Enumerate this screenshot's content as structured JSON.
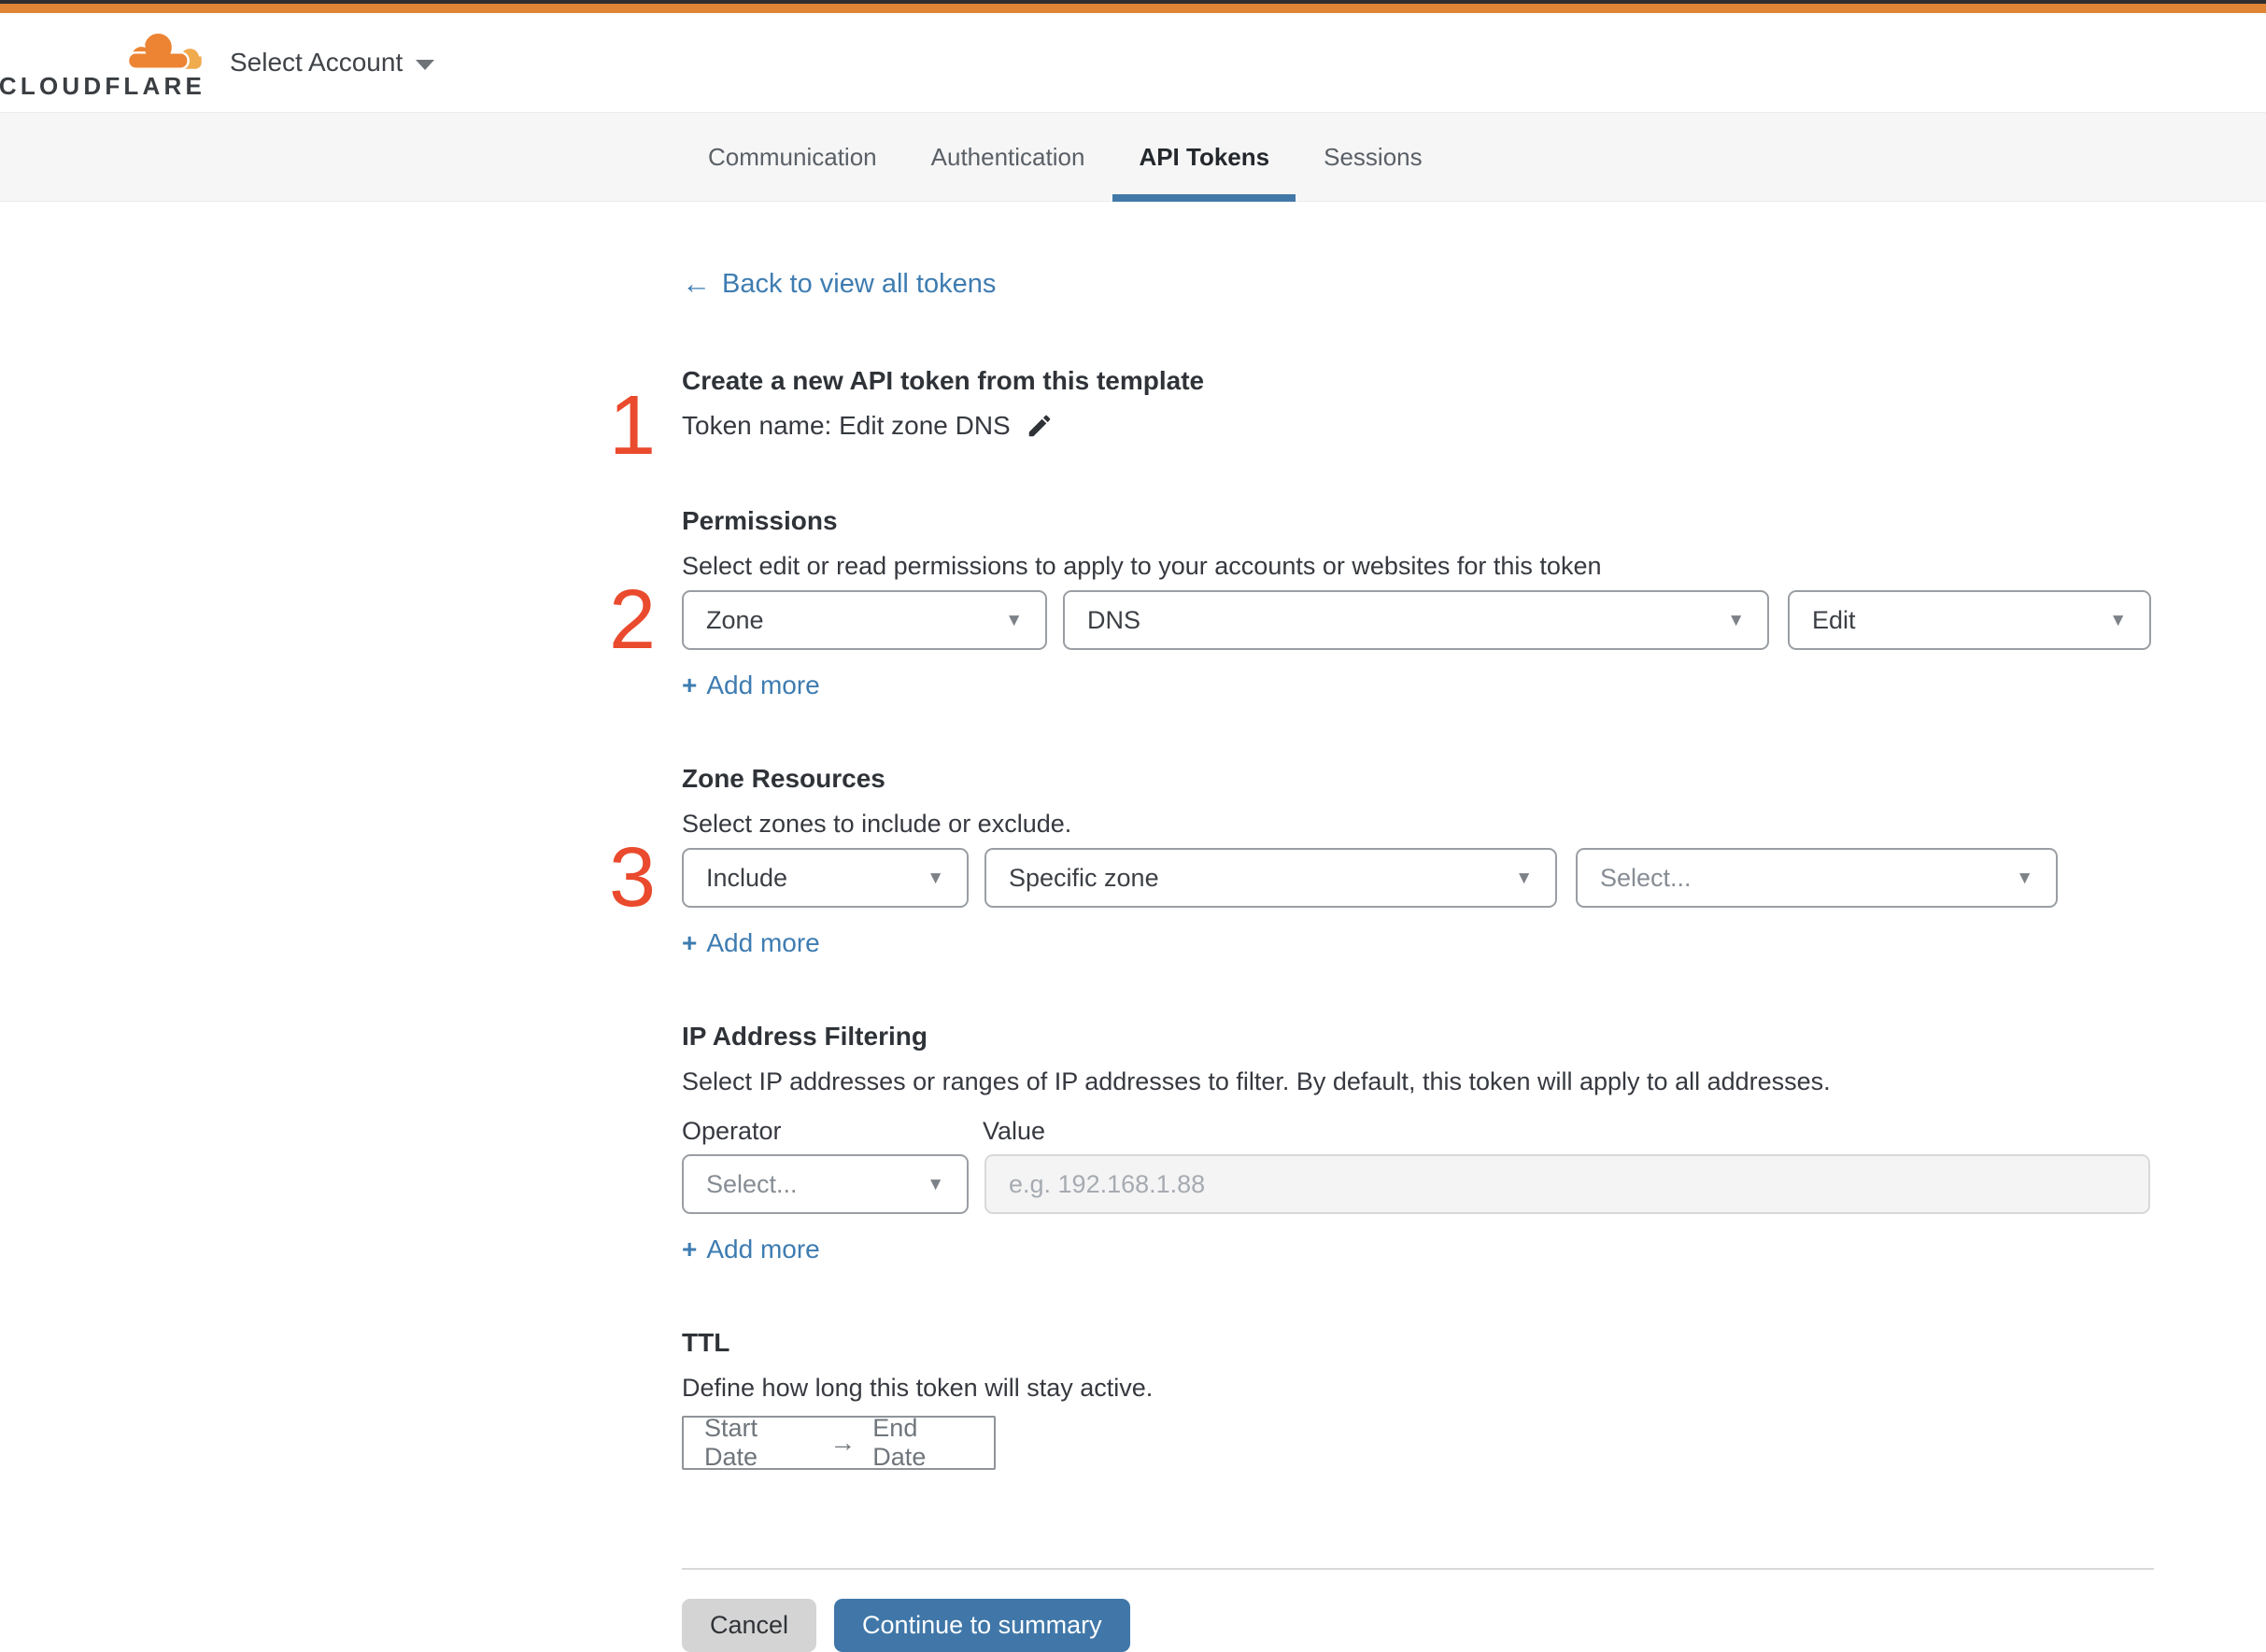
{
  "colors": {
    "accent_bar": "#e08436",
    "top_border": "#2e2e30",
    "link_blue": "#3e7cb1",
    "step_red": "#ea4a2d",
    "primary_blue": "#4077a8",
    "underline_blue": "#4278a8",
    "logo_orange": "#ec8434",
    "logo_light": "#f0ab4f",
    "logo_dark": "#3a3e42"
  },
  "icons": {
    "back_arrow": "←",
    "chevron_down": "▼",
    "arrow_right": "→",
    "plus": "+"
  },
  "header": {
    "logo_text": "CLOUDFLARE",
    "account_selector": "Select Account"
  },
  "tabs": {
    "items": [
      {
        "label": "Communication"
      },
      {
        "label": "Authentication"
      },
      {
        "label": "API Tokens",
        "active": true
      },
      {
        "label": "Sessions"
      }
    ]
  },
  "page": {
    "back_link": "Back to view all tokens",
    "create": {
      "step_number": "1",
      "title": "Create a new API token from this template",
      "token_name": "Token name: Edit zone DNS"
    },
    "permissions": {
      "step_number": "2",
      "title": "Permissions",
      "description": "Select edit or read permissions to apply to your accounts or websites for this token",
      "scope": "Zone",
      "permission_group": "DNS",
      "access_level": "Edit",
      "add_more": "Add more"
    },
    "zone_resources": {
      "step_number": "3",
      "title": "Zone Resources",
      "description": "Select zones to include or exclude.",
      "operator": "Include",
      "scope": "Specific zone",
      "zone_placeholder": "Select...",
      "add_more": "Add more"
    },
    "ip_filtering": {
      "title": "IP Address Filtering",
      "description": "Select IP addresses or ranges of IP addresses to filter. By default, this token will apply to all addresses.",
      "operator_label": "Operator",
      "value_label": "Value",
      "operator_placeholder": "Select...",
      "value_placeholder": "e.g. 192.168.1.88",
      "add_more": "Add more"
    },
    "ttl": {
      "title": "TTL",
      "description": "Define how long this token will stay active.",
      "start_label": "Start Date",
      "end_label": "End Date"
    },
    "actions": {
      "cancel": "Cancel",
      "continue": "Continue to summary"
    }
  }
}
